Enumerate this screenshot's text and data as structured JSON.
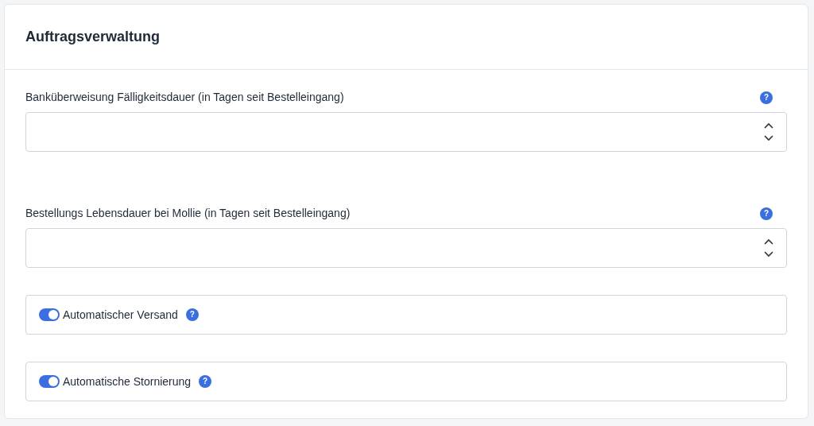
{
  "card": {
    "title": "Auftragsverwaltung"
  },
  "number_fields": [
    {
      "label": "Banküberweisung Fälligkeitsdauer (in Tagen seit Bestelleingang)",
      "help": "?"
    },
    {
      "label": "Bestellungs Lebensdauer bei Mollie (in Tagen seit Bestelleingang)",
      "help": "?"
    }
  ],
  "toggles": [
    {
      "label": "Automatischer Versand",
      "on": true,
      "help": "?"
    },
    {
      "label": "Automatische Stornierung",
      "on": true,
      "help": "?"
    }
  ]
}
